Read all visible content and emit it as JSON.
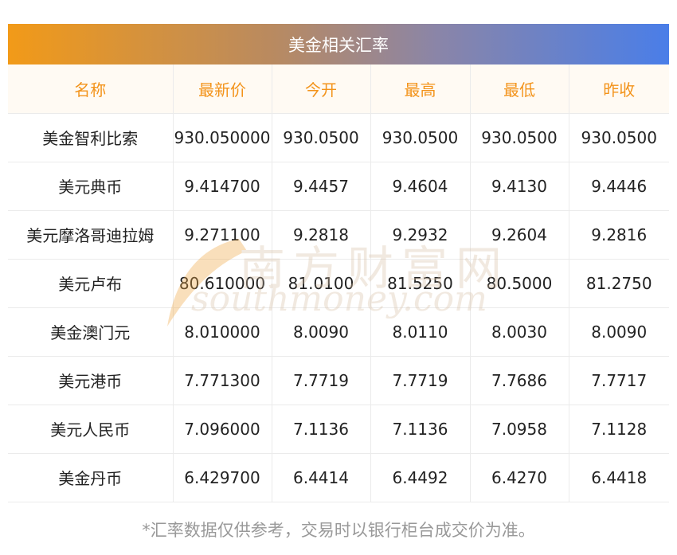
{
  "title": "美金相关汇率",
  "headers": [
    "名称",
    "最新价",
    "今开",
    "最高",
    "最低",
    "昨收"
  ],
  "rows": [
    [
      "美金智利比索",
      "930.050000",
      "930.0500",
      "930.0500",
      "930.0500",
      "930.0500"
    ],
    [
      "美元典币",
      "9.414700",
      "9.4457",
      "9.4604",
      "9.4130",
      "9.4446"
    ],
    [
      "美元摩洛哥迪拉姆",
      "9.271100",
      "9.2818",
      "9.2932",
      "9.2604",
      "9.2816"
    ],
    [
      "美元卢布",
      "80.610000",
      "81.0100",
      "81.5250",
      "80.5000",
      "81.2750"
    ],
    [
      "美金澳门元",
      "8.010000",
      "8.0090",
      "8.0110",
      "8.0030",
      "8.0090"
    ],
    [
      "美元港币",
      "7.771300",
      "7.7719",
      "7.7719",
      "7.7686",
      "7.7717"
    ],
    [
      "美元人民币",
      "7.096000",
      "7.1136",
      "7.1136",
      "7.0958",
      "7.1128"
    ],
    [
      "美金丹币",
      "6.429700",
      "6.4414",
      "6.4492",
      "6.4270",
      "6.4418"
    ]
  ],
  "watermark": {
    "cn": "南方财富网",
    "en": "southmoney.com"
  },
  "footnote": "*汇率数据仅供参考，交易时以银行柜台成交价为准。",
  "colors": {
    "header_text": "#f3931a",
    "title_gradient_start": "#f29a18",
    "title_gradient_end": "#4a7ee8"
  }
}
